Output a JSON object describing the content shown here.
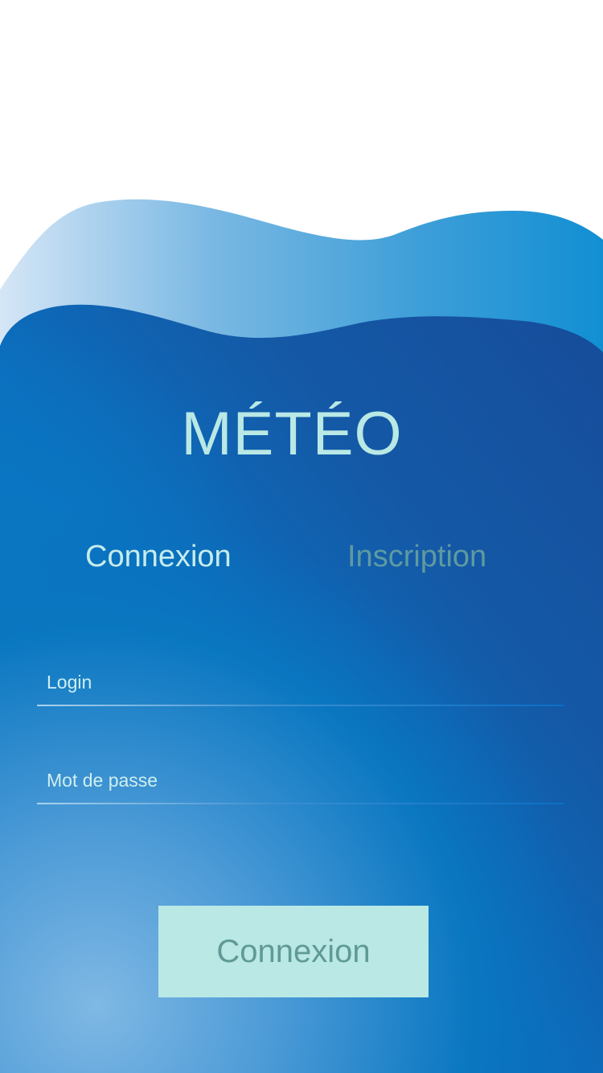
{
  "app": {
    "title": "MÉTÉO"
  },
  "tabs": [
    {
      "label": "Connexion",
      "active": true
    },
    {
      "label": "Inscription",
      "active": false
    }
  ],
  "form": {
    "login": {
      "placeholder": "Login",
      "value": ""
    },
    "password": {
      "placeholder": "Mot de passe",
      "value": ""
    },
    "submit_label": "Connexion"
  },
  "colors": {
    "accent_text": "#b9e8e5",
    "inactive_tab": "#5f9aa1",
    "button_bg": "#b9e8e5",
    "button_text": "#5f9a96",
    "deep_blue": "#164e9c",
    "mid_blue": "#0675bf",
    "light_blue": "#7cb8e3"
  }
}
